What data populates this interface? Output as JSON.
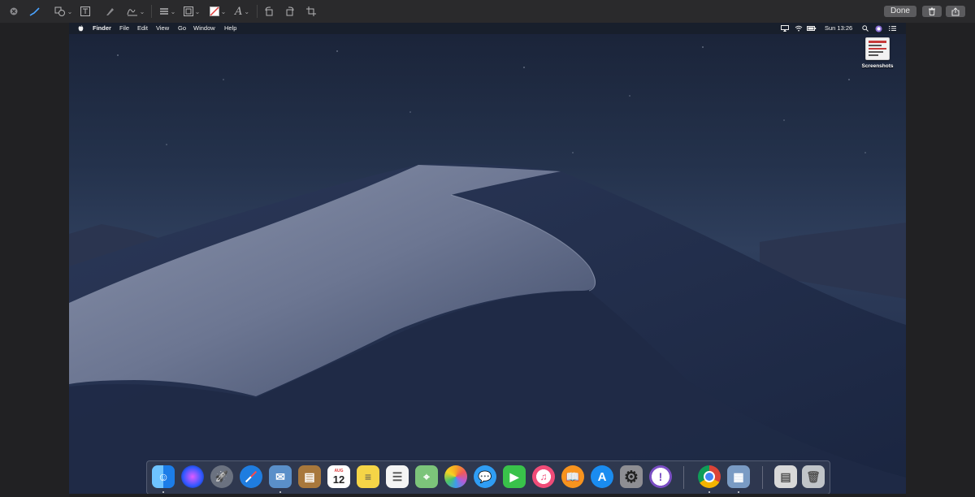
{
  "toolbar": {
    "tools": [
      "close-icon",
      "sketch-pen-icon",
      "shapes-icon",
      "text-box-icon",
      "highlight-icon",
      "signature-icon",
      "line-style-icon",
      "border-color-icon",
      "fill-color-icon",
      "text-style-icon",
      "rotate-left-icon",
      "rotate-right-icon",
      "crop-icon"
    ],
    "done_label": "Done",
    "delete_icon": "trash-icon",
    "share_icon": "share-icon"
  },
  "menubar": {
    "apple_icon": "apple-icon",
    "app_name": "Finder",
    "items": [
      "File",
      "Edit",
      "View",
      "Go",
      "Window",
      "Help"
    ],
    "clock": "Sun 13:26",
    "status_icons": [
      "airplay-icon",
      "wifi-icon",
      "battery-icon",
      "search-icon",
      "siri-icon",
      "notification-center-icon"
    ]
  },
  "desktop": {
    "icons": [
      {
        "label": "Screenshots",
        "icon": "screenshot-file-icon"
      }
    ]
  },
  "dock": {
    "apps": [
      {
        "name": "Finder",
        "icon": "finder-icon",
        "color": "#3b8ee8",
        "running": true
      },
      {
        "name": "Siri",
        "icon": "siri-icon",
        "color": "#2c2c54",
        "running": false
      },
      {
        "name": "Launchpad",
        "icon": "launchpad-icon",
        "color": "#6b7280",
        "running": false
      },
      {
        "name": "Safari",
        "icon": "safari-icon",
        "color": "#1f7de0",
        "running": false
      },
      {
        "name": "Mail",
        "icon": "mail-icon",
        "color": "#5a8fc9",
        "running": true
      },
      {
        "name": "Contacts",
        "icon": "contacts-icon",
        "color": "#a8783c",
        "running": false
      },
      {
        "name": "Calendar",
        "icon": "calendar-icon",
        "color": "#ffffff",
        "running": false,
        "day": "12",
        "month": "AUG"
      },
      {
        "name": "Notes",
        "icon": "notes-icon",
        "color": "#f5d547",
        "running": false
      },
      {
        "name": "Reminders",
        "icon": "reminders-icon",
        "color": "#f4f4f4",
        "running": false
      },
      {
        "name": "Maps",
        "icon": "maps-icon",
        "color": "#7cc47a",
        "running": false
      },
      {
        "name": "Photos",
        "icon": "photos-icon",
        "color": "#ffffff",
        "running": false
      },
      {
        "name": "Messages",
        "icon": "messages-icon",
        "color": "#2f9df4",
        "running": false
      },
      {
        "name": "FaceTime",
        "icon": "facetime-icon",
        "color": "#39c24a",
        "running": false
      },
      {
        "name": "iTunes",
        "icon": "itunes-icon",
        "color": "#ffffff",
        "running": false
      },
      {
        "name": "iBooks",
        "icon": "books-icon",
        "color": "#f7931e",
        "running": false
      },
      {
        "name": "App Store",
        "icon": "app-store-icon",
        "color": "#1a8cf0",
        "running": false
      },
      {
        "name": "System Preferences",
        "icon": "system-preferences-icon",
        "color": "#8e8e93",
        "running": false
      },
      {
        "name": "Feedback Assistant",
        "icon": "feedback-assistant-icon",
        "color": "#7b4fc4",
        "running": false
      },
      {
        "name": "Chrome",
        "icon": "chrome-icon",
        "color": "#ffffff",
        "running": true
      },
      {
        "name": "Preview",
        "icon": "preview-icon",
        "color": "#7a9bc4",
        "running": true
      },
      {
        "name": "Documents",
        "icon": "documents-stack-icon",
        "color": "#d8d8d8",
        "running": false
      },
      {
        "name": "Trash",
        "icon": "trash-icon",
        "color": "#c0c4c8",
        "running": false
      }
    ]
  }
}
